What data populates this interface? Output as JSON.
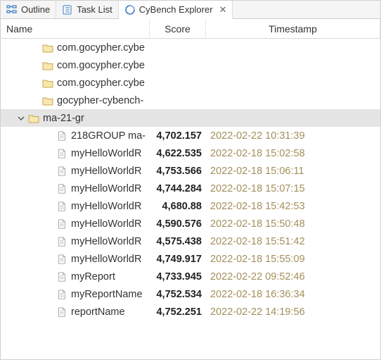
{
  "tabs": [
    {
      "id": "outline",
      "label": "Outline",
      "iconColor": "#3a7ac2",
      "active": false
    },
    {
      "id": "tasklist",
      "label": "Task List",
      "iconColor": "#3a7ac2",
      "active": false
    },
    {
      "id": "cybench",
      "label": "CyBench Explorer",
      "iconColor": "#3a7ac2",
      "active": true,
      "closable": true
    }
  ],
  "columns": {
    "name": "Name",
    "score": "Score",
    "ts": "Timestamp"
  },
  "tree": [
    {
      "type": "folder",
      "name": "com.gocypher.cybe",
      "depth": 1
    },
    {
      "type": "folder",
      "name": "com.gocypher.cybe",
      "depth": 1
    },
    {
      "type": "folder",
      "name": "com.gocypher.cybe",
      "depth": 1
    },
    {
      "type": "folder",
      "name": "gocypher-cybench-",
      "depth": 1
    },
    {
      "type": "folder",
      "name": "ma-21-gr",
      "depth": 0,
      "expanded": true,
      "selected": true,
      "children": [
        {
          "type": "file",
          "name": "218GROUP ma-",
          "score": "4,702.157",
          "ts": "2022-02-22 10:31:39"
        },
        {
          "type": "file",
          "name": "myHelloWorldR",
          "score": "4,622.535",
          "ts": "2022-02-18 15:02:58"
        },
        {
          "type": "file",
          "name": "myHelloWorldR",
          "score": "4,753.566",
          "ts": "2022-02-18 15:06:11"
        },
        {
          "type": "file",
          "name": "myHelloWorldR",
          "score": "4,744.284",
          "ts": "2022-02-18 15:07:15"
        },
        {
          "type": "file",
          "name": "myHelloWorldR",
          "score": "4,680.88",
          "ts": "2022-02-18 15:42:53"
        },
        {
          "type": "file",
          "name": "myHelloWorldR",
          "score": "4,590.576",
          "ts": "2022-02-18 15:50:48"
        },
        {
          "type": "file",
          "name": "myHelloWorldR",
          "score": "4,575.438",
          "ts": "2022-02-18 15:51:42"
        },
        {
          "type": "file",
          "name": "myHelloWorldR",
          "score": "4,749.917",
          "ts": "2022-02-18 15:55:09"
        },
        {
          "type": "file",
          "name": "myReport",
          "score": "4,733.945",
          "ts": "2022-02-22 09:52:46"
        },
        {
          "type": "file",
          "name": "myReportName",
          "score": "4,752.534",
          "ts": "2022-02-18 16:36:34"
        },
        {
          "type": "file",
          "name": "reportName",
          "score": "4,752.251",
          "ts": "2022-02-22 14:19:56"
        }
      ]
    }
  ]
}
